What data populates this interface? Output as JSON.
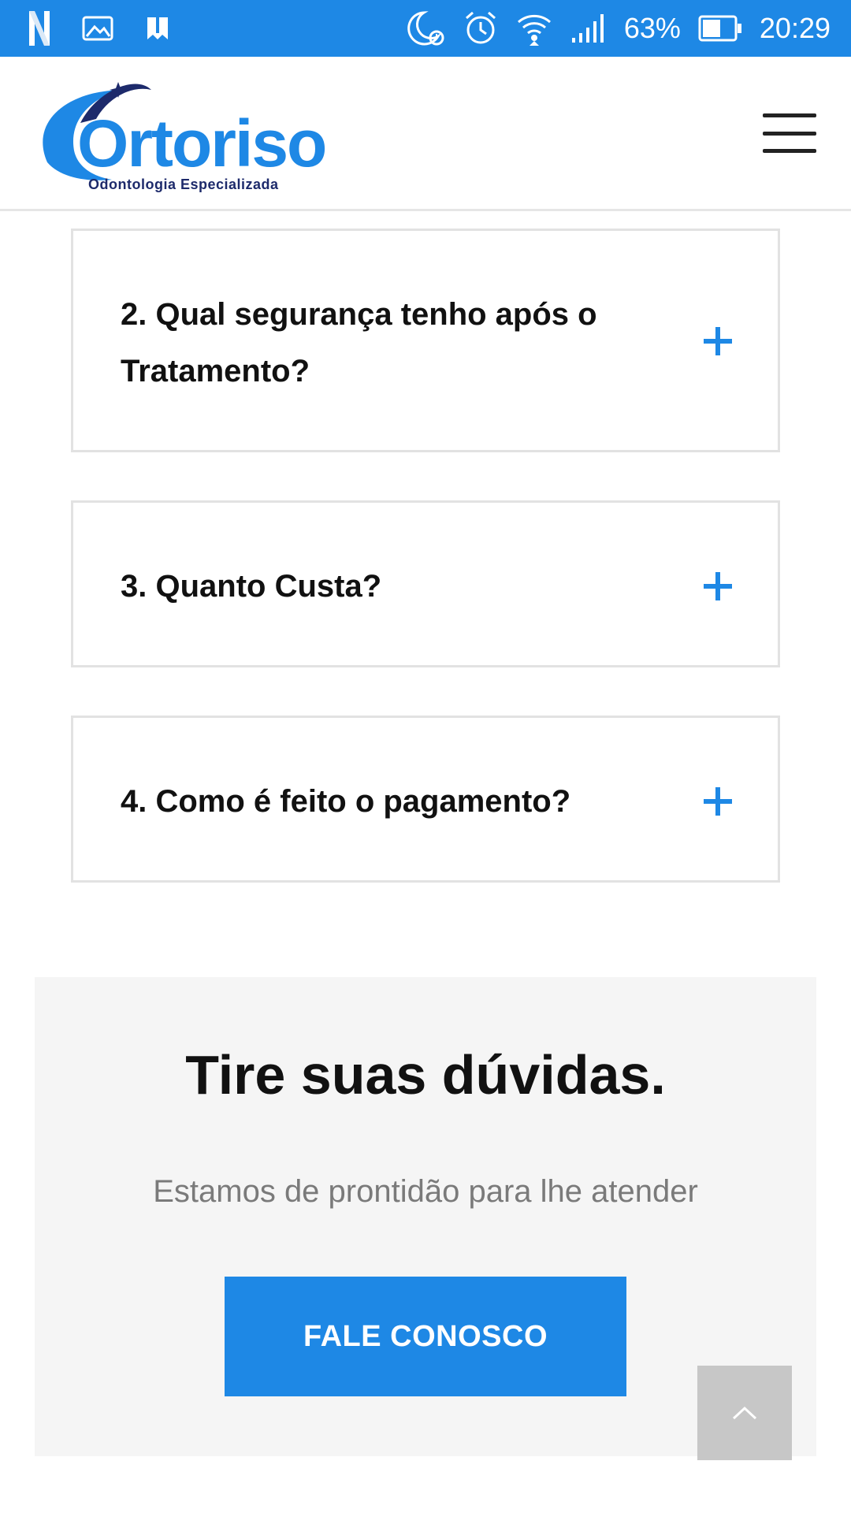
{
  "status_bar": {
    "battery": "63%",
    "time": "20:29",
    "icons": [
      "netflix-icon",
      "image-icon",
      "bookmark-icon",
      "night-alarm-icon",
      "alarm-icon",
      "wifi-icon",
      "signal-icon",
      "battery-icon"
    ]
  },
  "header": {
    "logo_name": "Ortoriso",
    "logo_tagline": "Odontologia Especializada",
    "menu_icon": "hamburger-menu-icon"
  },
  "faq": {
    "items": [
      {
        "question": "2. Qual segurança tenho após o Tratamento?"
      },
      {
        "question": "3. Quanto Custa?"
      },
      {
        "question": "4. Como é feito o pagamento?"
      }
    ],
    "expand_icon": "plus-icon"
  },
  "cta": {
    "title": "Tire suas dúvidas.",
    "subtitle": "Estamos de prontidão para lhe atender",
    "button_label": "FALE CONOSCO"
  },
  "back_to_top_icon": "chevron-up-icon",
  "colors": {
    "accent": "#1e88e5",
    "brand_dark": "#1d2a6b",
    "cta_background": "#f5f5f5",
    "back_to_top_background": "#c7c7c7"
  }
}
